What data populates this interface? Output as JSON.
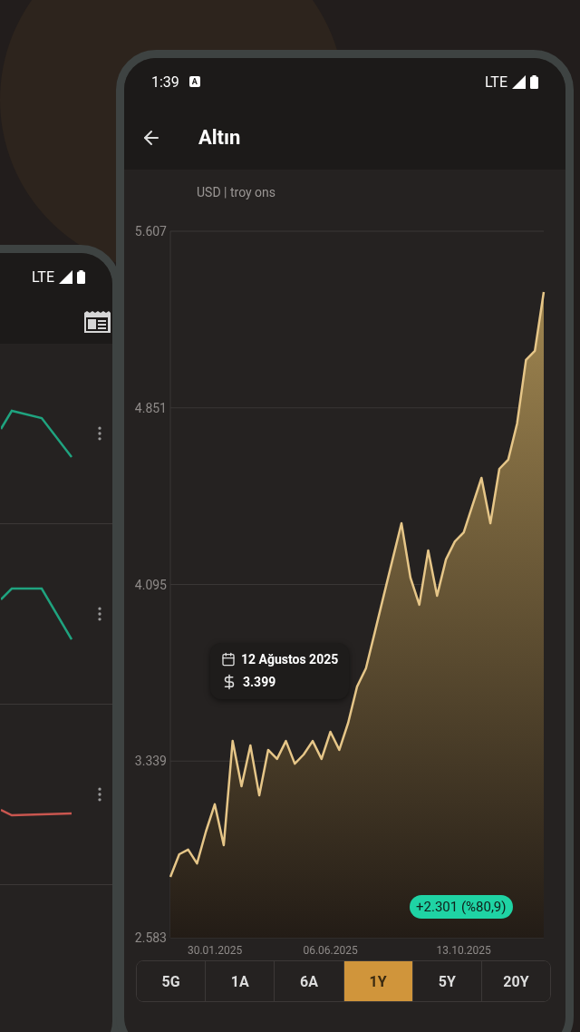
{
  "back_phone": {
    "status": {
      "network": "LTE"
    },
    "rows": [
      {
        "color": "#1fa37f"
      },
      {
        "color": "#1fa37f"
      },
      {
        "color": "#c9564f"
      }
    ]
  },
  "status_bar": {
    "time": "1:39",
    "notification": "A",
    "network": "LTE"
  },
  "app_bar": {
    "title": "Altın"
  },
  "unit_label": "USD | troy ons",
  "chart": {
    "chart_data": {
      "type": "area",
      "categories": [
        null,
        null,
        null,
        null,
        null,
        "30.01.2025",
        null,
        null,
        null,
        null,
        null,
        null,
        null,
        null,
        null,
        null,
        null,
        null,
        "06.06.2025",
        null,
        null,
        null,
        null,
        null,
        null,
        null,
        null,
        null,
        null,
        null,
        null,
        null,
        null,
        "13.10.2025",
        null,
        null,
        null,
        null,
        null,
        null,
        null,
        null,
        null
      ],
      "grid": true,
      "series": [
        {
          "color": "#e6c688",
          "values": [
            2843,
            2940,
            2960,
            2901,
            3037,
            3154,
            2979,
            3425,
            3231,
            3406,
            3192,
            3387,
            3348,
            3425,
            3328,
            3367,
            3425,
            3348,
            3464,
            3387,
            3503,
            3658,
            3736,
            3891,
            4047,
            4202,
            4357,
            4124,
            4008,
            4241,
            4047,
            4202,
            4279,
            4318,
            4435,
            4551,
            4357,
            4590,
            4629,
            4784,
            5056,
            5095,
            5347
          ]
        }
      ],
      "ylim": [
        2583,
        5607
      ],
      "yticks": [
        {
          "value": 2583,
          "label": "2.583"
        },
        {
          "value": 3339,
          "label": "3.339"
        },
        {
          "value": 4095,
          "label": "4.095"
        },
        {
          "value": 4851,
          "label": "4.851"
        },
        {
          "value": 5607,
          "label": "5.607"
        }
      ]
    },
    "tooltip": {
      "date": "12 Ağustos 2025",
      "value": "3.399"
    },
    "change_badge": "+2.301 (%80,9)"
  },
  "range_tabs": [
    {
      "label": "5G",
      "selected": false
    },
    {
      "label": "1A",
      "selected": false
    },
    {
      "label": "6A",
      "selected": false
    },
    {
      "label": "1Y",
      "selected": true
    },
    {
      "label": "5Y",
      "selected": false
    },
    {
      "label": "20Y",
      "selected": false
    }
  ]
}
